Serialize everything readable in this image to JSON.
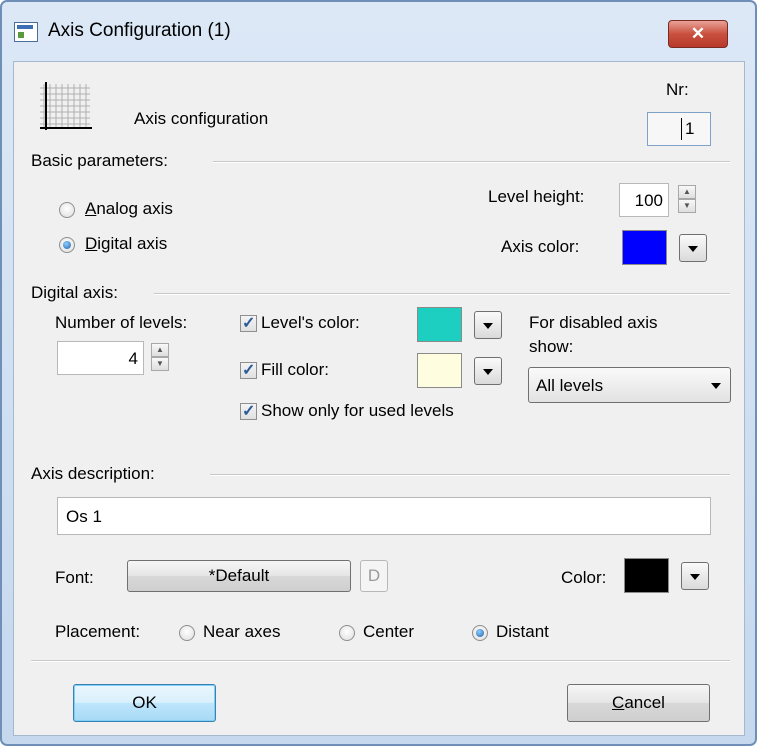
{
  "window": {
    "title": "Axis Configuration (1)",
    "close_glyph": "✕"
  },
  "header": {
    "label": "Axis configuration",
    "nr_label": "Nr:",
    "nr_value": "1"
  },
  "basic": {
    "section_title": "Basic parameters:",
    "analog_label_first": "A",
    "analog_label_rest": "nalog axis",
    "digital_label_first": "D",
    "digital_label_rest": "igital axis",
    "selected": "Digital axis",
    "level_height_label": "Level height:",
    "level_height_value": "100",
    "axis_color_label": "Axis color:",
    "axis_color": "#0000ff"
  },
  "digital": {
    "section_title": "Digital axis:",
    "num_levels_label": "Number of levels:",
    "num_levels_value": "4",
    "levels_color_label": "Level's color:",
    "levels_color_checked": true,
    "levels_color": "#1ccfc0",
    "fill_color_label": "Fill color:",
    "fill_color_checked": true,
    "fill_color": "#fffde0",
    "show_used_label": "Show only for used levels",
    "show_used_checked": true,
    "disabled_label_line1": "For disabled axis",
    "disabled_label_line2": "show:",
    "disabled_value": "All levels"
  },
  "description": {
    "section_title": "Axis description:",
    "value": "Os 1",
    "font_label": "Font:",
    "font_button": "*Default",
    "d_button": "D",
    "color_label": "Color:",
    "color": "#000000",
    "placement_label": "Placement:",
    "placement_options": [
      "Near axes",
      "Center",
      "Distant"
    ],
    "placement_selected": "Distant"
  },
  "buttons": {
    "ok": "OK",
    "cancel_first": "C",
    "cancel_rest": "ancel"
  }
}
